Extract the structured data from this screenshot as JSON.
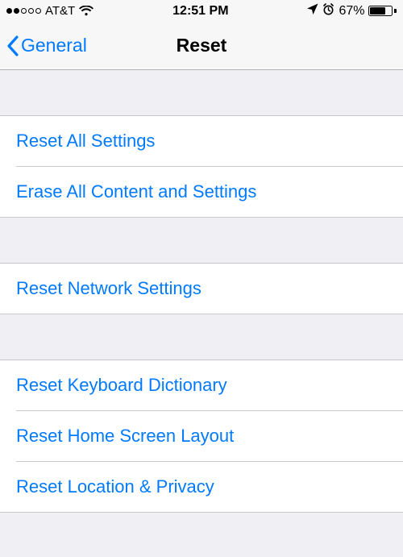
{
  "status": {
    "carrier": "AT&T",
    "time": "12:51 PM",
    "battery_pct": "67%"
  },
  "nav": {
    "back_label": "General",
    "title": "Reset"
  },
  "groups": [
    {
      "items": [
        "Reset All Settings",
        "Erase All Content and Settings"
      ]
    },
    {
      "items": [
        "Reset Network Settings"
      ]
    },
    {
      "items": [
        "Reset Keyboard Dictionary",
        "Reset Home Screen Layout",
        "Reset Location & Privacy"
      ]
    }
  ],
  "colors": {
    "tint": "#007aff",
    "bg": "#efeff4",
    "separator": "#c8c7cc"
  }
}
